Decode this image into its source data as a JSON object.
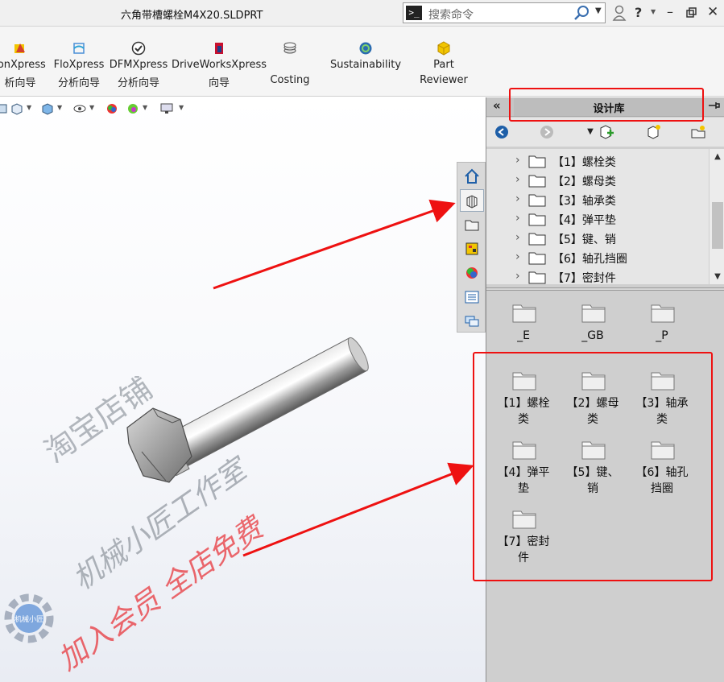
{
  "titlebar": {
    "doc_title": "六角带槽螺栓M4X20.SLDPRT",
    "search_placeholder": "搜索命令"
  },
  "ribbon": {
    "items": [
      {
        "line1": "ionXpress",
        "line2": "析向导",
        "icon": "simulationxpress-icon"
      },
      {
        "line1": "FloXpress",
        "line2": "分析向导",
        "icon": "floxpress-icon"
      },
      {
        "line1": "DFMXpress",
        "line2": "分析向导",
        "icon": "dfmxpress-icon"
      },
      {
        "line1": "DriveWorksXpress",
        "line2": "向导",
        "icon": "driveworksxpress-icon"
      },
      {
        "line1": "",
        "line2": "Costing",
        "icon": "costing-icon"
      },
      {
        "line1": "Sustainability",
        "line2": "",
        "icon": "sustainability-icon"
      },
      {
        "line1": "Part",
        "line2": "Reviewer",
        "icon": "part-reviewer-icon"
      }
    ]
  },
  "taskpane": {
    "title": "设计库",
    "tree": [
      {
        "label": "【1】螺栓类"
      },
      {
        "label": "【2】螺母类"
      },
      {
        "label": "【3】轴承类"
      },
      {
        "label": "【4】弹平垫"
      },
      {
        "label": "【5】键、销"
      },
      {
        "label": "【6】轴孔挡圈"
      },
      {
        "label": "【7】密封件"
      }
    ],
    "top_folders": [
      {
        "label": "_E"
      },
      {
        "label": "_GB"
      },
      {
        "label": "_P"
      }
    ],
    "folders": [
      {
        "label": "【1】螺栓类"
      },
      {
        "label": "【2】螺母类"
      },
      {
        "label": "【3】轴承类"
      },
      {
        "label": "【4】弹平垫"
      },
      {
        "label": "【5】键、销"
      },
      {
        "label": "【6】轴孔挡圈"
      },
      {
        "label": "【7】密封件"
      }
    ]
  },
  "watermark": {
    "line1": "淘宝店铺",
    "line2": "机械小匠工作室",
    "line3": "加入会员 全店免费",
    "logo_text": "机械小匠"
  },
  "colors": {
    "annotation_red": "#ee1111",
    "watermark_gray": "#9aa0a8",
    "watermark_red": "#e8373d"
  }
}
